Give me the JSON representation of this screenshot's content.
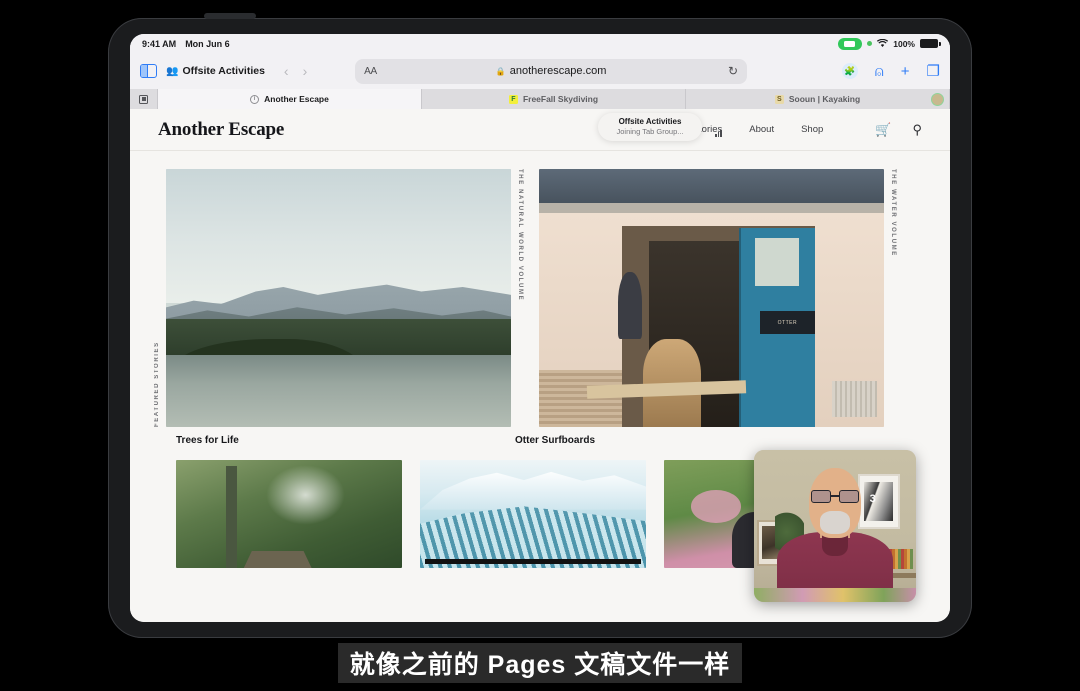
{
  "status_bar": {
    "time": "9:41 AM",
    "date": "Mon Jun 6",
    "battery_percent": "100%",
    "camera_icon": "camera-active-icon",
    "privacy_dot": "green-privacy-dot",
    "wifi_icon": "wifi-icon",
    "battery_icon": "battery-full-icon"
  },
  "safari_toolbar": {
    "sidebar_icon": "sidebar-toggle-icon",
    "people_icon": "shared-tab-group-people-icon",
    "tab_group_name": "Offsite Activities",
    "back_icon": "chevron-left-icon",
    "forward_icon": "chevron-right-icon",
    "text_size_label": "AA",
    "lock_icon": "lock-icon",
    "url": "anotherescape.com",
    "reload_icon": "reload-icon",
    "extension_icon": "extension-puzzle-icon",
    "share_icon": "share-icon",
    "new_tab_icon": "plus-icon",
    "tab_overview_icon": "tabs-overview-icon"
  },
  "tab_bar": {
    "start_tab_icon": "start-page-icon",
    "tabs": [
      {
        "title": "Another Escape",
        "favicon": "circle-info-favicon",
        "active": true
      },
      {
        "title": "FreeFall Skydiving",
        "favicon": "freefall-f-favicon",
        "active": false
      },
      {
        "title": "Sooun | Kayaking",
        "favicon": "sooun-s-favicon",
        "active": false
      }
    ],
    "participant_avatar": "participant-avatar"
  },
  "site": {
    "brand": "Another Escape",
    "nav_links": [
      "Featured Stories",
      "About",
      "Shop"
    ],
    "cart_icon": "shopping-cart-icon",
    "search_icon": "search-icon",
    "toast": {
      "title": "Offsite Activities",
      "subtitle": "Joining Tab Group...",
      "signal_icon": "signal-bars-icon"
    },
    "hero": [
      {
        "vertical_label": "FEATURED STORIES",
        "vertical_label_right": "THE NATURAL WORLD VOLUME",
        "caption": "Trees for Life",
        "image_name": "mountains-and-lake-photo"
      },
      {
        "vertical_label_right": "THE WATER VOLUME",
        "caption": "Otter Surfboards",
        "image_name": "otter-surfboards-workshop-photo"
      }
    ],
    "thumbnails": [
      {
        "image_name": "mossy-forest-cabin-photo"
      },
      {
        "image_name": "ski-slope-illustration"
      },
      {
        "image_name": "wildflower-meadow-photo"
      }
    ]
  },
  "facetime": {
    "pip_name": "facetime-video-tile",
    "frame_number": "3"
  },
  "subtitle": {
    "text": "就像之前的 Pages 文稿文件一样"
  },
  "colors": {
    "accent_blue": "#2f7cf6",
    "status_green": "#31c85a",
    "page_bg": "#f7f6f4",
    "chrome_bg": "#f2f1f4"
  }
}
